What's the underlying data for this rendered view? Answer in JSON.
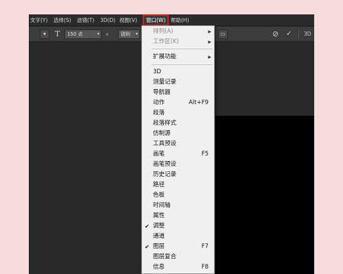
{
  "menubar": {
    "items": [
      {
        "label": "文字(Y)"
      },
      {
        "label": "选择(S)"
      },
      {
        "label": "滤镜(T)"
      },
      {
        "label": "3D(D)"
      },
      {
        "label": "视图(V)"
      },
      {
        "label": "窗口(W)"
      },
      {
        "label": "帮助(H)"
      }
    ]
  },
  "optbar": {
    "font_size_value": "150 点",
    "aa_prefix": "a",
    "aa_value": "锐利",
    "right_label": "3D"
  },
  "window_menu": {
    "items": [
      {
        "label": "排列(A)",
        "disabled": true,
        "submenu": true
      },
      {
        "label": "工作区(K)",
        "disabled": true,
        "submenu": true
      },
      {
        "label": "扩展功能",
        "submenu": true
      },
      {
        "label": "3D"
      },
      {
        "label": "测量记录"
      },
      {
        "label": "导航器"
      },
      {
        "label": "动作",
        "shortcut": "Alt+F9"
      },
      {
        "label": "段落"
      },
      {
        "label": "段落样式"
      },
      {
        "label": "仿制源"
      },
      {
        "label": "工具预设"
      },
      {
        "label": "画笔",
        "shortcut": "F5"
      },
      {
        "label": "画笔预设"
      },
      {
        "label": "历史记录"
      },
      {
        "label": "路径"
      },
      {
        "label": "色板"
      },
      {
        "label": "时间轴"
      },
      {
        "label": "属性"
      },
      {
        "label": "调整",
        "checked": true
      },
      {
        "label": "通道"
      },
      {
        "label": "图层",
        "shortcut": "F7",
        "checked": true
      },
      {
        "label": "图层复合"
      },
      {
        "label": "信息",
        "shortcut": "F8"
      }
    ]
  }
}
